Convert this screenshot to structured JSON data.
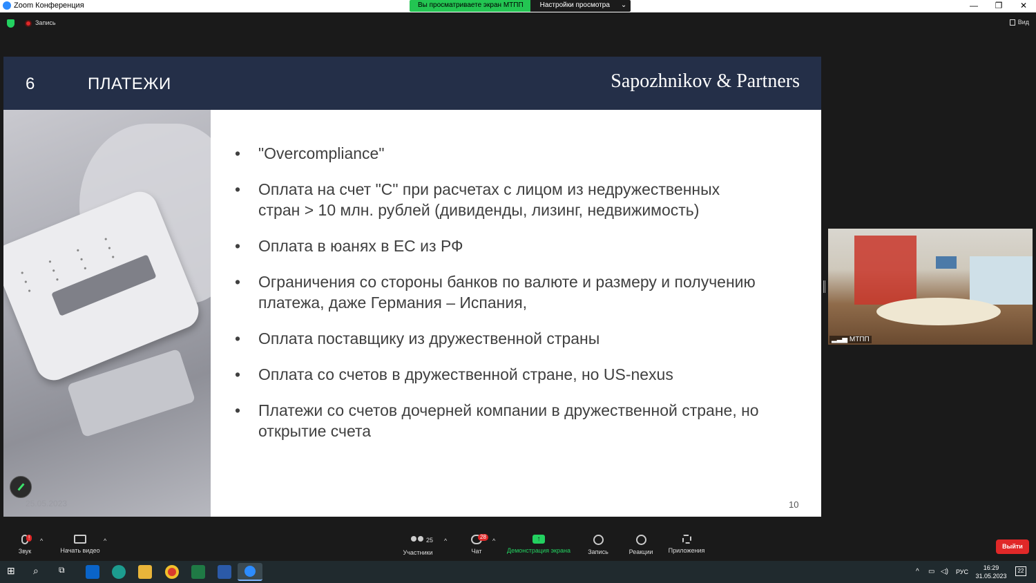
{
  "window": {
    "title": "Zoom Конференция",
    "banner_viewing": "Вы просматриваете экран МТПП",
    "banner_settings": "Настройки просмотра",
    "view_label": "Вид",
    "recording_label": "Запись"
  },
  "slide": {
    "number": "6",
    "title": "ПЛАТЕЖИ",
    "brand": "Sapozhnikov & Partners",
    "bullets": [
      "\"Overcompliance\"",
      "Оплата на счет \"С\" при расчетах с лицом из недружественных стран  > 10 млн. рублей (дивиденды, лизинг,  недвижимость)",
      "Оплата в юанях в ЕС из РФ",
      "Ограничения со стороны банков по валюте и размеру и получению платежа, даже Германия – Испания,",
      "Оплата поставщику из дружественной страны",
      "Оплата со счетов в дружественной стране, но US-nexus",
      "Платежи со счетов дочерней компании в дружественной стране, но открытие счета"
    ],
    "page": "10",
    "photo_date": "25.05.2023"
  },
  "video": {
    "participant_name": "МТПП"
  },
  "toolbar": {
    "audio": "Звук",
    "video": "Начать видео",
    "participants": "Участники",
    "participants_count": "25",
    "chat": "Чат",
    "chat_badge": "28",
    "share": "Демонстрация экрана",
    "record": "Запись",
    "reactions": "Реакции",
    "apps": "Приложения",
    "leave": "Выйти",
    "audio_badge": "!"
  },
  "taskbar": {
    "language": "РУС",
    "time": "16:29",
    "date": "31.05.2023",
    "notifications": "22"
  },
  "colors": {
    "slide_header": "#242f48",
    "zoom_green": "#23d160",
    "leave_red": "#e02828"
  }
}
